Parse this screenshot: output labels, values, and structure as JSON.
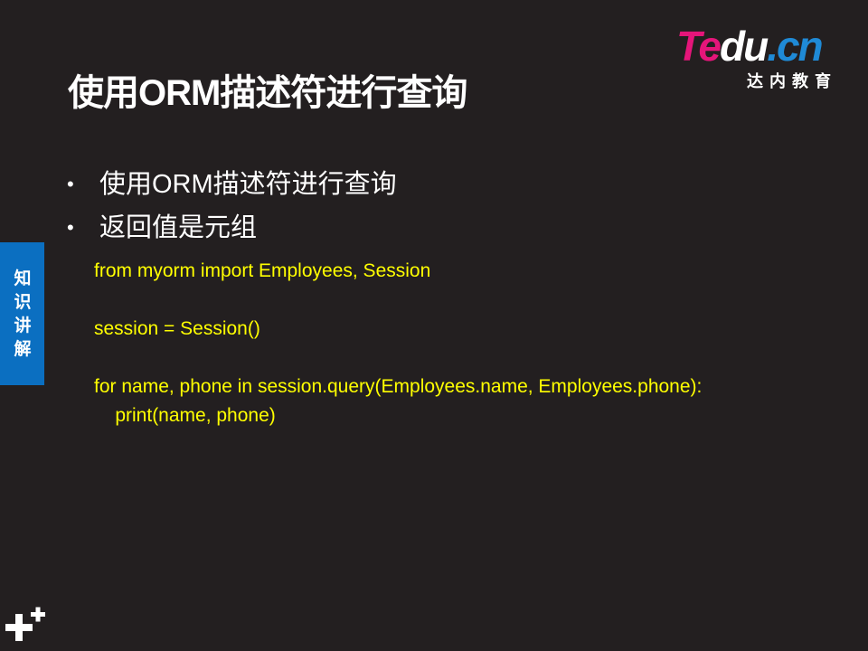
{
  "slide": {
    "title": "使用ORM描述符进行查询"
  },
  "logo": {
    "word_te": "Te",
    "word_du": "du",
    "word_cn": ".cn",
    "subtitle": "达内教育"
  },
  "bullets": [
    {
      "symbol": "•",
      "text": "使用ORM描述符进行查询"
    },
    {
      "symbol": "•",
      "text": "返回值是元组"
    }
  ],
  "code_lines": [
    "from myorm import Employees, Session",
    "",
    "session = Session()",
    "",
    "for name, phone in session.query(Employees.name, Employees.phone):",
    "    print(name, phone)"
  ],
  "side_tab": {
    "label": "知识讲解"
  },
  "icons": {
    "corner": "plus-plus-icon"
  },
  "colors": {
    "background": "#231f20",
    "code_text": "#ffff00",
    "side_tab": "#0b6fc1",
    "logo_pink": "#e5157a",
    "logo_blue": "#1f8ad6"
  }
}
